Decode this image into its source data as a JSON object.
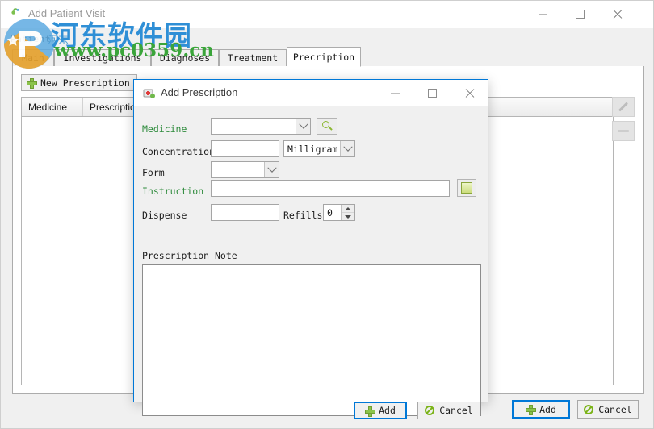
{
  "main_window": {
    "title": "Add Patient Visit",
    "title_icon": "medical-visit-icon",
    "controls": {
      "minimize": "minimize-icon",
      "maximize": "maximize-icon",
      "close": "close-icon"
    },
    "patient_label": "Patient",
    "tabs": [
      {
        "label": "Main",
        "active": false
      },
      {
        "label": "Investigations",
        "active": false
      },
      {
        "label": "Diagnoses",
        "active": false
      },
      {
        "label": "Treatment",
        "active": false
      },
      {
        "label": "Precription",
        "active": true
      }
    ],
    "toolbar": {
      "new_prescription_label": "New Prescription"
    },
    "grid": {
      "columns": [
        "Medicine",
        "Prescription"
      ],
      "rows": []
    },
    "side_buttons": [
      {
        "name": "edit-button",
        "icon": "pencil-icon",
        "enabled": false
      },
      {
        "name": "remove-button",
        "icon": "minus-icon",
        "enabled": false
      }
    ],
    "footer": {
      "add_label": "Add",
      "cancel_label": "Cancel"
    }
  },
  "dialog": {
    "title": "Add Prescription",
    "title_icon": "medical-kit-icon",
    "controls": {
      "minimize": "minimize-icon",
      "maximize": "maximize-icon",
      "close": "close-icon"
    },
    "fields": {
      "medicine": {
        "label": "Medicine",
        "value": "",
        "search_icon": "magnifier-icon"
      },
      "concentration": {
        "label": "Concentration",
        "value": "",
        "unit_value": "Milligram"
      },
      "form": {
        "label": "Form",
        "value": ""
      },
      "instruction": {
        "label": "Instruction",
        "value": "",
        "note_icon": "note-icon"
      },
      "dispense": {
        "label": "Dispense",
        "value": ""
      },
      "refills": {
        "label": "Refills",
        "value": "0"
      },
      "prescription_note": {
        "label": "Prescription Note",
        "value": ""
      }
    },
    "footer": {
      "add_label": "Add",
      "cancel_label": "Cancel"
    }
  },
  "watermark": {
    "site_name": "河东软件园",
    "url": "www.pc0359.cn",
    "short_name": "河东"
  },
  "colors": {
    "accent": "#0078d7",
    "green_label": "#2e8b3c",
    "watermark_blue": "#2f8fd6",
    "watermark_green": "#3aa53a",
    "icon_green": "#8bc34a"
  }
}
